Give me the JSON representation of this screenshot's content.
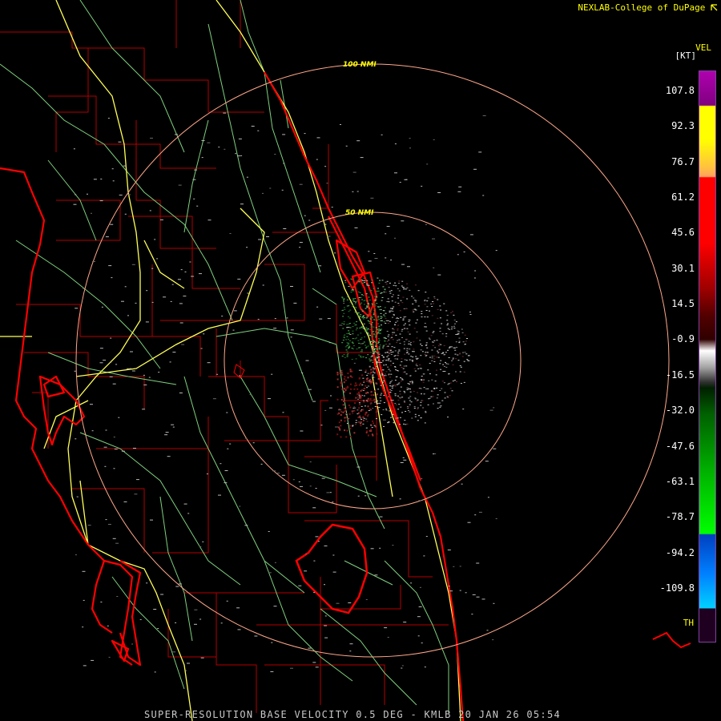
{
  "header": {
    "credit": "NEXLAB-College of DuPage",
    "credit_icon": "arrow-corner-icon"
  },
  "footer": {
    "product_line": "SUPER-RESOLUTION BASE VELOCITY 0.5 DEG - KMLB 20 JAN 26 05:54"
  },
  "range_rings": {
    "outer_label": "100 NMI",
    "inner_label": "50 NMI",
    "ring_color": "#ffa88a"
  },
  "legend": {
    "product": "VEL",
    "unit": "[KT]",
    "ticks": [
      "107.8",
      "92.3",
      "76.7",
      "61.2",
      "45.6",
      "30.1",
      "14.5",
      "-0.9",
      "-16.5",
      "-32.0",
      "-47.6",
      "-63.1",
      "-78.7",
      "-94.2",
      "-109.8"
    ],
    "th_label": "TH",
    "colors": {
      "purple": "#7a0080",
      "yellow": "#ffff00",
      "orange": "#ffae60",
      "red": "#ff0000",
      "dark_red": "#400000",
      "gray": "#c8c8c8",
      "dark_green": "#003000",
      "green": "#00e000",
      "blue": "#0050ff",
      "cyan": "#00c0ff"
    }
  },
  "map_colors": {
    "coastline": "#ff0000",
    "county_lines": "#b40000",
    "highways": "#ffff60",
    "roads": "#90e090"
  }
}
